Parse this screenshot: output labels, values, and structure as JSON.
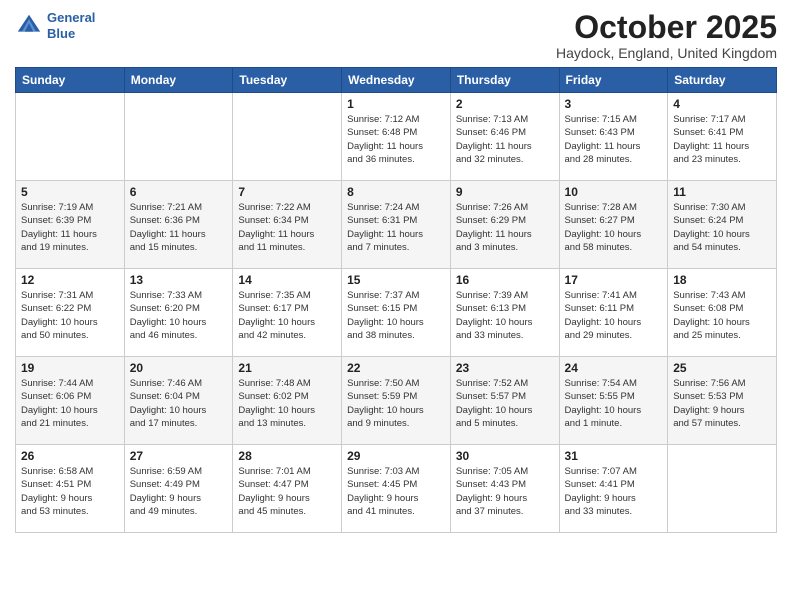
{
  "header": {
    "logo_line1": "General",
    "logo_line2": "Blue",
    "title": "October 2025",
    "subtitle": "Haydock, England, United Kingdom"
  },
  "weekdays": [
    "Sunday",
    "Monday",
    "Tuesday",
    "Wednesday",
    "Thursday",
    "Friday",
    "Saturday"
  ],
  "weeks": [
    [
      {
        "day": "",
        "info": ""
      },
      {
        "day": "",
        "info": ""
      },
      {
        "day": "",
        "info": ""
      },
      {
        "day": "1",
        "info": "Sunrise: 7:12 AM\nSunset: 6:48 PM\nDaylight: 11 hours\nand 36 minutes."
      },
      {
        "day": "2",
        "info": "Sunrise: 7:13 AM\nSunset: 6:46 PM\nDaylight: 11 hours\nand 32 minutes."
      },
      {
        "day": "3",
        "info": "Sunrise: 7:15 AM\nSunset: 6:43 PM\nDaylight: 11 hours\nand 28 minutes."
      },
      {
        "day": "4",
        "info": "Sunrise: 7:17 AM\nSunset: 6:41 PM\nDaylight: 11 hours\nand 23 minutes."
      }
    ],
    [
      {
        "day": "5",
        "info": "Sunrise: 7:19 AM\nSunset: 6:39 PM\nDaylight: 11 hours\nand 19 minutes."
      },
      {
        "day": "6",
        "info": "Sunrise: 7:21 AM\nSunset: 6:36 PM\nDaylight: 11 hours\nand 15 minutes."
      },
      {
        "day": "7",
        "info": "Sunrise: 7:22 AM\nSunset: 6:34 PM\nDaylight: 11 hours\nand 11 minutes."
      },
      {
        "day": "8",
        "info": "Sunrise: 7:24 AM\nSunset: 6:31 PM\nDaylight: 11 hours\nand 7 minutes."
      },
      {
        "day": "9",
        "info": "Sunrise: 7:26 AM\nSunset: 6:29 PM\nDaylight: 11 hours\nand 3 minutes."
      },
      {
        "day": "10",
        "info": "Sunrise: 7:28 AM\nSunset: 6:27 PM\nDaylight: 10 hours\nand 58 minutes."
      },
      {
        "day": "11",
        "info": "Sunrise: 7:30 AM\nSunset: 6:24 PM\nDaylight: 10 hours\nand 54 minutes."
      }
    ],
    [
      {
        "day": "12",
        "info": "Sunrise: 7:31 AM\nSunset: 6:22 PM\nDaylight: 10 hours\nand 50 minutes."
      },
      {
        "day": "13",
        "info": "Sunrise: 7:33 AM\nSunset: 6:20 PM\nDaylight: 10 hours\nand 46 minutes."
      },
      {
        "day": "14",
        "info": "Sunrise: 7:35 AM\nSunset: 6:17 PM\nDaylight: 10 hours\nand 42 minutes."
      },
      {
        "day": "15",
        "info": "Sunrise: 7:37 AM\nSunset: 6:15 PM\nDaylight: 10 hours\nand 38 minutes."
      },
      {
        "day": "16",
        "info": "Sunrise: 7:39 AM\nSunset: 6:13 PM\nDaylight: 10 hours\nand 33 minutes."
      },
      {
        "day": "17",
        "info": "Sunrise: 7:41 AM\nSunset: 6:11 PM\nDaylight: 10 hours\nand 29 minutes."
      },
      {
        "day": "18",
        "info": "Sunrise: 7:43 AM\nSunset: 6:08 PM\nDaylight: 10 hours\nand 25 minutes."
      }
    ],
    [
      {
        "day": "19",
        "info": "Sunrise: 7:44 AM\nSunset: 6:06 PM\nDaylight: 10 hours\nand 21 minutes."
      },
      {
        "day": "20",
        "info": "Sunrise: 7:46 AM\nSunset: 6:04 PM\nDaylight: 10 hours\nand 17 minutes."
      },
      {
        "day": "21",
        "info": "Sunrise: 7:48 AM\nSunset: 6:02 PM\nDaylight: 10 hours\nand 13 minutes."
      },
      {
        "day": "22",
        "info": "Sunrise: 7:50 AM\nSunset: 5:59 PM\nDaylight: 10 hours\nand 9 minutes."
      },
      {
        "day": "23",
        "info": "Sunrise: 7:52 AM\nSunset: 5:57 PM\nDaylight: 10 hours\nand 5 minutes."
      },
      {
        "day": "24",
        "info": "Sunrise: 7:54 AM\nSunset: 5:55 PM\nDaylight: 10 hours\nand 1 minute."
      },
      {
        "day": "25",
        "info": "Sunrise: 7:56 AM\nSunset: 5:53 PM\nDaylight: 9 hours\nand 57 minutes."
      }
    ],
    [
      {
        "day": "26",
        "info": "Sunrise: 6:58 AM\nSunset: 4:51 PM\nDaylight: 9 hours\nand 53 minutes."
      },
      {
        "day": "27",
        "info": "Sunrise: 6:59 AM\nSunset: 4:49 PM\nDaylight: 9 hours\nand 49 minutes."
      },
      {
        "day": "28",
        "info": "Sunrise: 7:01 AM\nSunset: 4:47 PM\nDaylight: 9 hours\nand 45 minutes."
      },
      {
        "day": "29",
        "info": "Sunrise: 7:03 AM\nSunset: 4:45 PM\nDaylight: 9 hours\nand 41 minutes."
      },
      {
        "day": "30",
        "info": "Sunrise: 7:05 AM\nSunset: 4:43 PM\nDaylight: 9 hours\nand 37 minutes."
      },
      {
        "day": "31",
        "info": "Sunrise: 7:07 AM\nSunset: 4:41 PM\nDaylight: 9 hours\nand 33 minutes."
      },
      {
        "day": "",
        "info": ""
      }
    ]
  ]
}
